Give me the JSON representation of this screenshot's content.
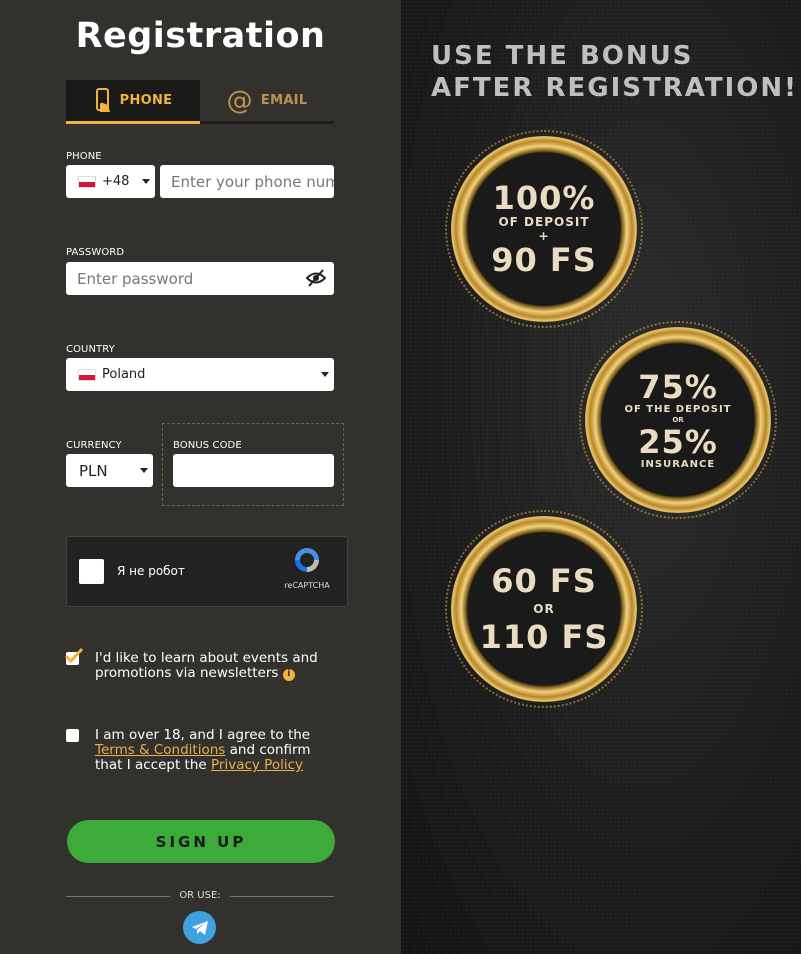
{
  "form": {
    "title": "Registration",
    "tabs": [
      {
        "label": "PHONE",
        "active": true
      },
      {
        "label": "EMAIL",
        "active": false
      }
    ],
    "phone": {
      "label": "PHONE",
      "code": "+48",
      "placeholder": "Enter your phone number"
    },
    "password": {
      "label": "PASSWORD",
      "placeholder": "Enter password"
    },
    "country": {
      "label": "COUNTRY",
      "value": "Poland"
    },
    "currency": {
      "label": "CURRENCY",
      "value": "PLN"
    },
    "bonus_code": {
      "label": "BONUS CODE",
      "value": ""
    },
    "captcha": {
      "text": "Я не робот",
      "brand": "reCAPTCHA"
    },
    "newsletter": {
      "line1": "I'd like to learn about events and",
      "line2": "promotions via newsletters",
      "checked": true
    },
    "terms": {
      "line1": "I am over 18, and I agree to the",
      "terms_link": "Terms & Conditions",
      "mid": "and confirm",
      "line3_pre": "that I accept the",
      "privacy_link": "Privacy Policy",
      "checked": false
    },
    "signup_label": "SIGN UP",
    "or_use": "OR USE:",
    "social": [
      "telegram-icon"
    ]
  },
  "promo": {
    "line1": "USE THE BONUS",
    "line2": "AFTER REGISTRATION!",
    "medals": [
      {
        "big1": "100%",
        "small1": "OF DEPOSIT",
        "plus": "+",
        "big2": "90 FS"
      },
      {
        "big1": "75%",
        "small1": "OF THE DEPOSIT",
        "or": "OR",
        "big2": "25%",
        "small2": "INSURANCE"
      },
      {
        "big1": "60 FS",
        "or": "OR",
        "big2": "110 FS"
      }
    ]
  },
  "colors": {
    "accent": "#f0b43c",
    "signup": "#3cab3a",
    "link": "#e8b04a",
    "telegram": "#3ea2de"
  }
}
